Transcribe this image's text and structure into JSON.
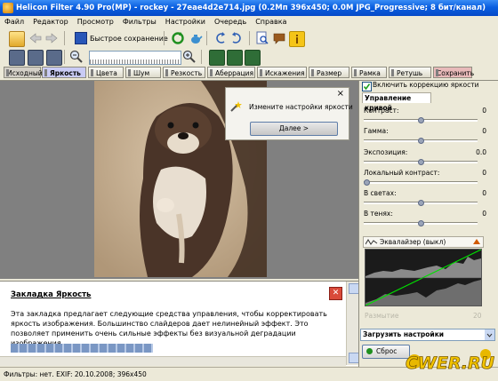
{
  "window": {
    "title": "Helicon Filter 4.90 Pro(MP) - rockey - 27eae4d2e714.jpg (0.2Mп 396х450; 0.0М JPG_Progressive; 8 бит/канал)"
  },
  "menu": [
    "Файл",
    "Редактор",
    "Просмотр",
    "Фильтры",
    "Настройки",
    "Очередь",
    "Справка"
  ],
  "toolbar": {
    "quick_save_label": "Быстрое сохранение"
  },
  "tabs": [
    {
      "label": "Исходный"
    },
    {
      "label": "Яркость"
    },
    {
      "label": "Цвета"
    },
    {
      "label": "Шум"
    },
    {
      "label": "Резкость"
    },
    {
      "label": "Аберрация"
    },
    {
      "label": "Искажения"
    },
    {
      "label": "Размер"
    },
    {
      "label": "Рамка"
    },
    {
      "label": "Ретушь"
    },
    {
      "label": "Сохранить"
    }
  ],
  "dialog": {
    "text": "Измените настройки яркости",
    "next_button": "Далее >",
    "close": "×"
  },
  "help": {
    "title": "Закладка Яркость",
    "body": "Эта закладка предлагает следующие средства управления, чтобы корректировать яркость изображения. Большинство слайдеров дает нелинейный эффект. Это позволяет применить очень сильные эффекты без визуальной деградации изображения."
  },
  "right_panel": {
    "enable_checkbox": "Включить коррекцию яркости",
    "enable_checked": true,
    "section_title": "Управление кривой",
    "sliders": [
      {
        "label": "Контраст:",
        "value": "0",
        "level": 0.5
      },
      {
        "label": "Гамма:",
        "value": "0",
        "level": 0.5
      },
      {
        "label": "Экспозиция:",
        "value": "0.0",
        "level": 0.5
      },
      {
        "label": "Локальный контраст:",
        "value": "0",
        "level": 0.0
      },
      {
        "label": "В светах:",
        "value": "0",
        "level": 0.5
      },
      {
        "label": "В тенях:",
        "value": "0",
        "level": 0.5
      }
    ],
    "equalizer_label": "Эквалайзер (выкл)",
    "faded_label": "Размытие",
    "faded_value": "20",
    "load_settings": "Загрузить настройки",
    "reset_button": "Сброс"
  },
  "status": {
    "text": "Фильтры: нет. EXIF: 20.10.2008; 396x450"
  },
  "watermark": "CWER.RU",
  "colors": {
    "titlebar": "#0a5fe0",
    "active_tab": "#c9cbf5",
    "save_tab": "#e8b9b9",
    "curve_line": "#00e000"
  }
}
